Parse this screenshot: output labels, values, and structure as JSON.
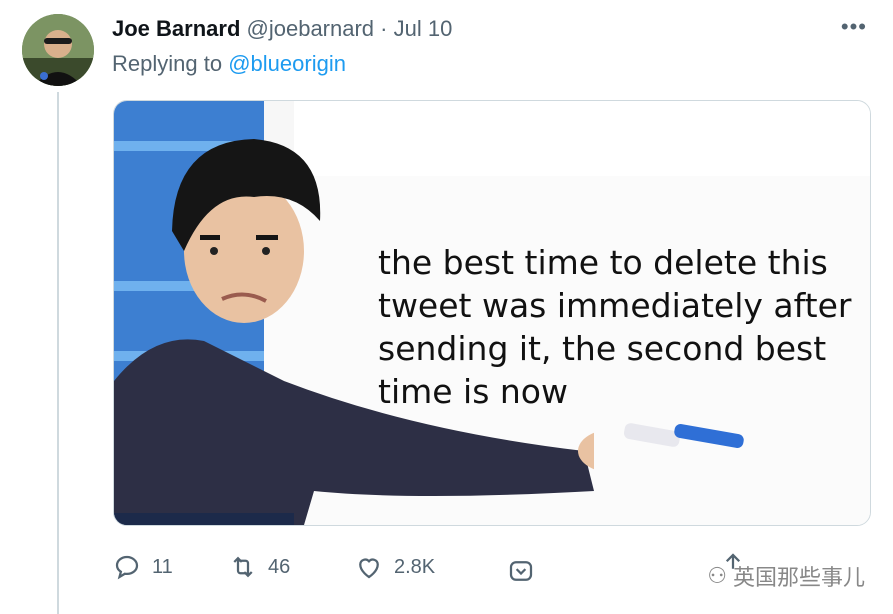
{
  "tweet": {
    "display_name": "Joe Barnard",
    "handle": "@joebarnard",
    "separator": "·",
    "date": "Jul 10",
    "more_label": "•••",
    "replying_prefix": "Replying to",
    "replying_mention": "@blueorigin"
  },
  "media": {
    "caption_lines": [
      "the best time to delete this",
      "tweet was immediately after",
      "sending it, the second best",
      "time is now"
    ]
  },
  "actions": {
    "reply_count": "11",
    "retweet_count": "46",
    "like_count": "2.8K"
  },
  "watermark": {
    "text": "英国那些事儿"
  },
  "icons": {
    "reply": "reply-icon",
    "retweet": "retweet-icon",
    "like": "heart-icon",
    "share": "share-icon",
    "tip": "tip-icon"
  },
  "colors": {
    "mention": "#1d9bf0",
    "secondary_text": "#536471",
    "thread_line": "#cfd9de"
  }
}
